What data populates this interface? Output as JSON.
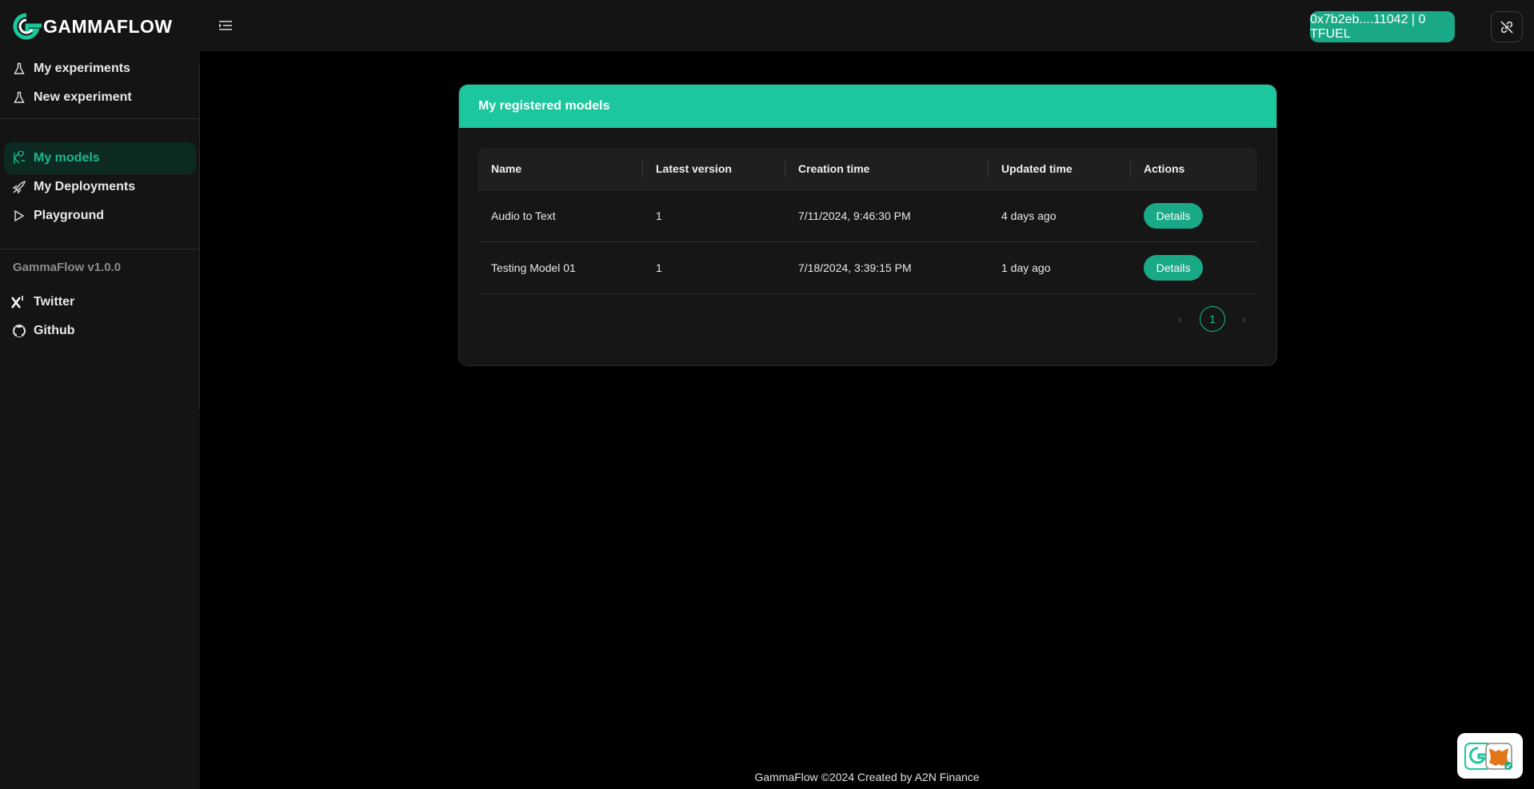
{
  "brand": {
    "name": "GAMMAFLOW"
  },
  "topbar": {
    "wallet_label": "0x7b2eb....11042 | 0 TFUEL"
  },
  "sidebar": {
    "items": [
      {
        "label": "My experiments",
        "icon": "flask-icon"
      },
      {
        "label": "New experiment",
        "icon": "flask-icon"
      },
      {
        "label": "My models",
        "icon": "model-icon",
        "active": true
      },
      {
        "label": "My Deployments",
        "icon": "rocket-icon"
      },
      {
        "label": "Playground",
        "icon": "play-icon"
      }
    ],
    "version": "GammaFlow v1.0.0",
    "links": [
      {
        "label": "Twitter",
        "icon": "x-logo-icon"
      },
      {
        "label": "Github",
        "icon": "github-icon"
      }
    ]
  },
  "card": {
    "title": "My registered models",
    "columns": [
      "Name",
      "Latest version",
      "Creation time",
      "Updated time",
      "Actions"
    ],
    "rows": [
      {
        "name": "Audio to Text",
        "version": "1",
        "created": "7/11/2024, 9:46:30 PM",
        "updated": "4 days ago",
        "action": "Details"
      },
      {
        "name": "Testing Model 01",
        "version": "1",
        "created": "7/18/2024, 3:39:15 PM",
        "updated": "1 day ago",
        "action": "Details"
      }
    ],
    "pagination": {
      "current": "1",
      "prev": "‹",
      "next": "›"
    }
  },
  "footer": {
    "text": "GammaFlow ©2024 Created by A2N Finance"
  },
  "colors": {
    "accent": "#1cc79d",
    "button": "#19a987",
    "background": "#000000",
    "panel": "#141414"
  }
}
